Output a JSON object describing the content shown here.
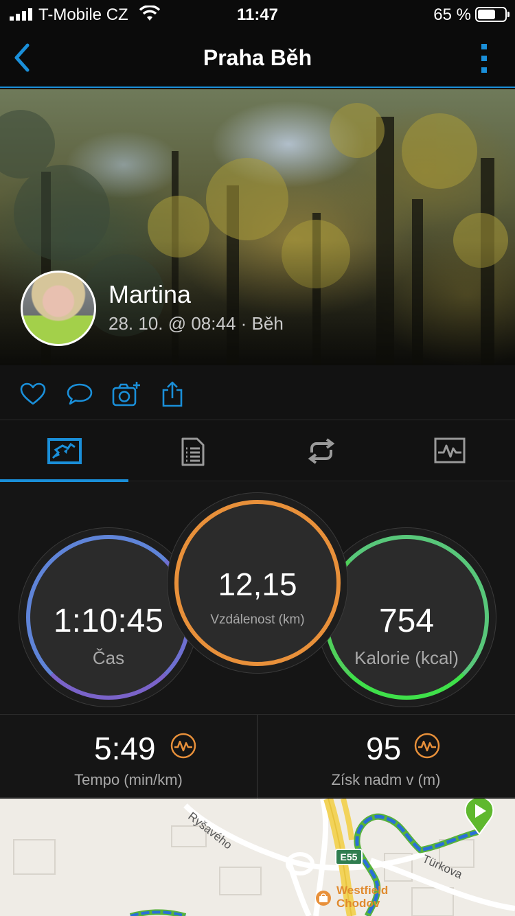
{
  "status_bar": {
    "carrier": "T-Mobile CZ",
    "time": "11:47",
    "battery_percent_text": "65 %",
    "battery_level": 0.65
  },
  "nav": {
    "title": "Praha Běh",
    "back_icon": "chevron-left-icon",
    "more_icon": "vertical-dots-icon"
  },
  "activity": {
    "user_name": "Martina",
    "meta": "28. 10. @ 08:44 · Běh"
  },
  "actions": [
    {
      "name": "like",
      "icon": "heart-icon"
    },
    {
      "name": "comment",
      "icon": "speech-bubble-icon"
    },
    {
      "name": "add-photo",
      "icon": "camera-plus-icon"
    },
    {
      "name": "share",
      "icon": "share-icon"
    }
  ],
  "tabs": [
    {
      "name": "overview",
      "icon": "overview-map-icon",
      "active": true
    },
    {
      "name": "details",
      "icon": "document-list-icon",
      "active": false
    },
    {
      "name": "laps",
      "icon": "laps-loop-icon",
      "active": false
    },
    {
      "name": "charts",
      "icon": "chart-pulse-icon",
      "active": false
    }
  ],
  "stats": {
    "time": {
      "value": "1:10:45",
      "label": "Čas"
    },
    "distance": {
      "value": "12,15",
      "label": "Vzdálenost (km)"
    },
    "calories": {
      "value": "754",
      "label": "Kalorie (kcal)"
    }
  },
  "secondary": {
    "pace": {
      "value": "5:49",
      "label": "Tempo (min/km)",
      "icon": "pulse-badge-icon"
    },
    "elevation": {
      "value": "95",
      "label": "Získ nadm v (m)",
      "icon": "pulse-badge-icon"
    }
  },
  "map": {
    "street_1": "Ryšavého",
    "street_2": "Türkova",
    "road_badge": "E55",
    "poi_line1": "Westfield",
    "poi_line2": "Chodov"
  },
  "colors": {
    "accent_blue": "#1a8fd9",
    "time_ring": "#6e6fd0",
    "distance_ring": "#e8903a",
    "calories_ring": "#3fe04a",
    "route": "#2a6fd6",
    "start_marker": "#5fb82e"
  }
}
